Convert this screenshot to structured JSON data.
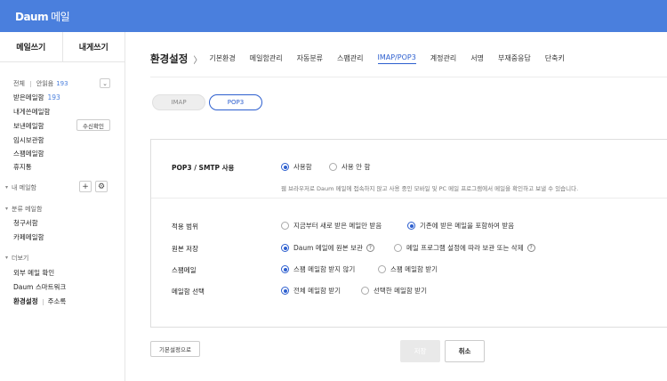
{
  "app": {
    "logo": "Daum",
    "service": "메일"
  },
  "compose": {
    "write": "메일쓰기",
    "self": "내게쓰기"
  },
  "sidebar": {
    "filter_all": "전체",
    "filter_unread": "안읽음",
    "unread_count": "193",
    "toggle_icon": "chevron-down-icon",
    "inbox": "받은메일함",
    "inbox_count": "193",
    "tome": "내게쓴메일함",
    "sent": "보낸메일함",
    "sent_check": "수신확인",
    "drafts": "임시보관함",
    "spam": "스팸메일함",
    "trash": "휴지통",
    "my_folders": "내 메일함",
    "category": "분류 메일함",
    "bill": "청구서함",
    "cafe": "카페메일함",
    "more": "더보기",
    "external": "외부 메일 확인",
    "smartwork": "Daum 스마트워크",
    "settings": "환경설정",
    "address": "주소록"
  },
  "header": {
    "title": "환경설정",
    "tabs": [
      "기본환경",
      "메일함관리",
      "자동분류",
      "스팸관리",
      "IMAP/POP3",
      "계정관리",
      "서명",
      "부재중응답",
      "단축키"
    ],
    "active_tab": "IMAP/POP3"
  },
  "protocol": {
    "imap": "IMAP",
    "pop3": "POP3",
    "selected": "POP3"
  },
  "form": {
    "use_label": "POP3 / SMTP 사용",
    "use_on": "사용함",
    "use_off": "사용 안 함",
    "desc": "웹 브라우저로 Daum 메일에 접속하지 않고 사용 중인 모바일 및 PC 메일 프로그램에서 메일을 확인하고 보낼 수 있습니다.",
    "scope_label": "적용 범위",
    "scope_new": "지금부터 새로 받은 메일만 받음",
    "scope_all": "기존에 받은 메일을 포함하여 받음",
    "keep_label": "원본 저장",
    "keep_daum": "Daum 메일에 원본 보관",
    "keep_program": "메일 프로그램 설정에 따라 보관 또는 삭제",
    "spam_label": "스팸메일",
    "spam_no": "스팸 메일함 받지 않기",
    "spam_yes": "스팸 메일함 받기",
    "box_label": "메일함 선택",
    "box_all": "전체 메일함 받기",
    "box_selected": "선택한 메일함 받기"
  },
  "buttons": {
    "default": "기본설정으로",
    "save": "저장",
    "cancel": "취소"
  }
}
